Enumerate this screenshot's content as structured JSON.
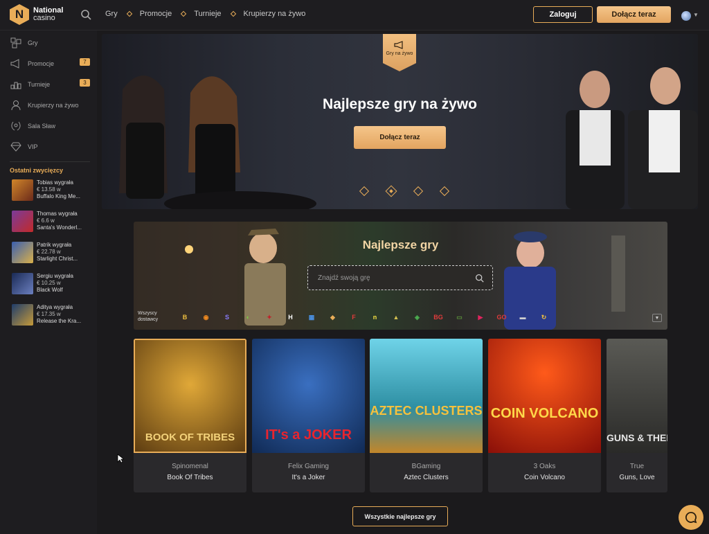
{
  "brand": {
    "name_line1": "National",
    "name_line2": "casino",
    "logo_letter": "N",
    "accent": "#e9ad58"
  },
  "nav": {
    "items": [
      "Gry",
      "Promocje",
      "Turnieje",
      "Krupierzy na żywo"
    ]
  },
  "header": {
    "login_label": "Zaloguj",
    "join_label": "Dołącz teraz"
  },
  "sidebar": {
    "items": [
      {
        "label": "Gry",
        "icon": "games-icon"
      },
      {
        "label": "Promocje",
        "icon": "megaphone-icon",
        "badge": "7"
      },
      {
        "label": "Turnieje",
        "icon": "tournament-icon",
        "badge": "3"
      },
      {
        "label": "Krupierzy na żywo",
        "icon": "dealer-icon"
      },
      {
        "label": "Sala Sław",
        "icon": "laurel-icon"
      },
      {
        "label": "VIP",
        "icon": "diamond-icon"
      }
    ],
    "winners_title": "Ostatni zwycięzcy",
    "winners": [
      {
        "name": "Tobias wygrała",
        "amount": "€ 13.58 w",
        "game": "Buffalo King Me..."
      },
      {
        "name": "Thomas wygrała",
        "amount": "€ 6.6 w",
        "game": "Santa's Wonderl..."
      },
      {
        "name": "Patrik wygrała",
        "amount": "€ 22.78 w",
        "game": "Starlight Christ..."
      },
      {
        "name": "Sergiu wygrała",
        "amount": "€ 10.25 w",
        "game": "Black Wolf"
      },
      {
        "name": "Aditya wygrała",
        "amount": "€ 17.35 w",
        "game": "Release the Kra..."
      }
    ]
  },
  "hero": {
    "badge_label": "Gry na żywo",
    "title": "Najlepsze gry na żywo",
    "button_label": "Dołącz teraz",
    "active_slide": 2,
    "slide_count": 4
  },
  "games_section": {
    "title": "Najlepsze gry",
    "search_placeholder": "Znajdź swoją grę",
    "providers_label_1": "Wszyscy",
    "providers_label_2": "dostawcy",
    "providers": [
      {
        "label": "B",
        "color": "#f0c040"
      },
      {
        "label": "◉",
        "color": "#f08a20"
      },
      {
        "label": "S",
        "color": "#8a7dff"
      },
      {
        "label": "◐",
        "color": "#7ac943"
      },
      {
        "label": "✦",
        "color": "#c0202a"
      },
      {
        "label": "H",
        "color": "#ffffff"
      },
      {
        "label": "▦",
        "color": "#4a90e2"
      },
      {
        "label": "◆",
        "color": "#e9ad58"
      },
      {
        "label": "F",
        "color": "#e33b3b"
      },
      {
        "label": "n",
        "color": "#f5e042"
      },
      {
        "label": "▲",
        "color": "#d4c050"
      },
      {
        "label": "◈",
        "color": "#4caf50"
      },
      {
        "label": "BG",
        "color": "#e33b3b"
      },
      {
        "label": "▭",
        "color": "#5a8f3a"
      },
      {
        "label": "▶",
        "color": "#e0245e"
      },
      {
        "label": "GO",
        "color": "#e33b3b"
      },
      {
        "label": "▬",
        "color": "#cfcfcf"
      },
      {
        "label": "↻",
        "color": "#f0c040"
      }
    ]
  },
  "cards": [
    {
      "provider": "Spinomenal",
      "game": "Book Of Tribes",
      "art_text": "BOOK OF TRIBES",
      "bg": "#6b4a12",
      "fg": "#f3d27a"
    },
    {
      "provider": "Felix Gaming",
      "game": "It's a Joker",
      "art_text": "IT's a JOKER",
      "bg": "#1a3f7a",
      "fg": "#e8242e"
    },
    {
      "provider": "BGaming",
      "game": "Aztec Clusters",
      "art_text": "AZTEC CLUSTERS",
      "bg": "#2e9fb3",
      "fg": "#f6c13d"
    },
    {
      "provider": "3 Oaks",
      "game": "Coin Volcano",
      "art_text": "COIN VOLCANO",
      "bg": "#b3170f",
      "fg": "#ffd84a"
    },
    {
      "provider": "True",
      "game": "Guns, Love",
      "art_text": "GUNS & THERA",
      "bg": "#3a3a38",
      "fg": "#e6e6e6"
    }
  ],
  "all_games_label": "Wszystkie najlepsze gry"
}
